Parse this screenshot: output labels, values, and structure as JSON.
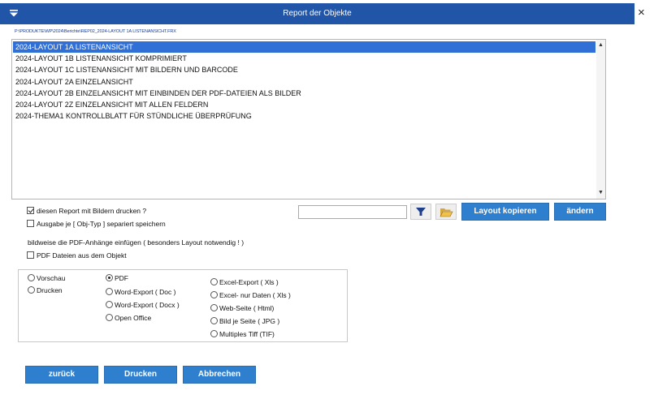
{
  "window": {
    "title": "Report der Objekte",
    "close_glyph": "×",
    "menu_icon": "triangle-down-icon"
  },
  "path": "P:\\PRODUKTE\\WP\\2024\\Berichte\\REP02_2024-LAYOUT 1A LISTENANSICHT.FRX",
  "report_list": {
    "items": [
      "2024-LAYOUT 1A LISTENANSICHT",
      "2024-LAYOUT 1B LISTENANSICHT KOMPRIMIERT",
      "2024-LAYOUT 1C LISTENANSICHT MIT BILDERN UND BARCODE",
      "2024-LAYOUT 2A EINZELANSICHT",
      "2024-LAYOUT 2B EINZELANSICHT MIT EINBINDEN DER PDF-DATEIEN ALS BILDER",
      "2024-LAYOUT 2Z EINZELANSICHT MIT ALLEN FELDERN",
      "2024-THEMA1 KONTROLLBLATT FÜR STÜNDLICHE ÜBERPRÜFUNG"
    ],
    "selected_index": 0
  },
  "options_top": {
    "print_images": {
      "label": "diesen Report mit Bildern drucken ?",
      "checked": true
    },
    "separate_save": {
      "label": "Ausgabe je [ Obj-Typ ] separiert speichern",
      "checked": false
    },
    "pdf_hint": "bildweise die PDF-Anhänge einfügen ( besonders Layout notwendig ! )",
    "pdf_from_object": {
      "label": "PDF Dateien aus dem Objekt",
      "checked": false
    }
  },
  "layout_tools": {
    "name_input_value": "",
    "filter_icon": "filter-icon",
    "folder_icon": "folder-open-icon",
    "copy_label": "Layout kopieren",
    "change_label": "ändern"
  },
  "output_mode": {
    "options": [
      "Vorschau",
      "Drucken"
    ],
    "selected": null
  },
  "format": {
    "col1": [
      "PDF",
      "Word-Export ( Doc )",
      "Word-Export ( Docx )",
      "Open Office"
    ],
    "col2": [
      "Excel-Export ( Xls )",
      "Excel- nur Daten ( Xls )",
      "Web-Seite ( Html)",
      "Bild je Seite ( JPG )",
      "Multiples Tiff (TIF)"
    ],
    "selected": "PDF"
  },
  "buttons": {
    "back": "zurück",
    "print": "Drucken",
    "cancel": "Abbrechen"
  },
  "colors": {
    "titlebar": "#2155a8",
    "selection": "#2f6fd6",
    "button": "#2f7fcf"
  }
}
